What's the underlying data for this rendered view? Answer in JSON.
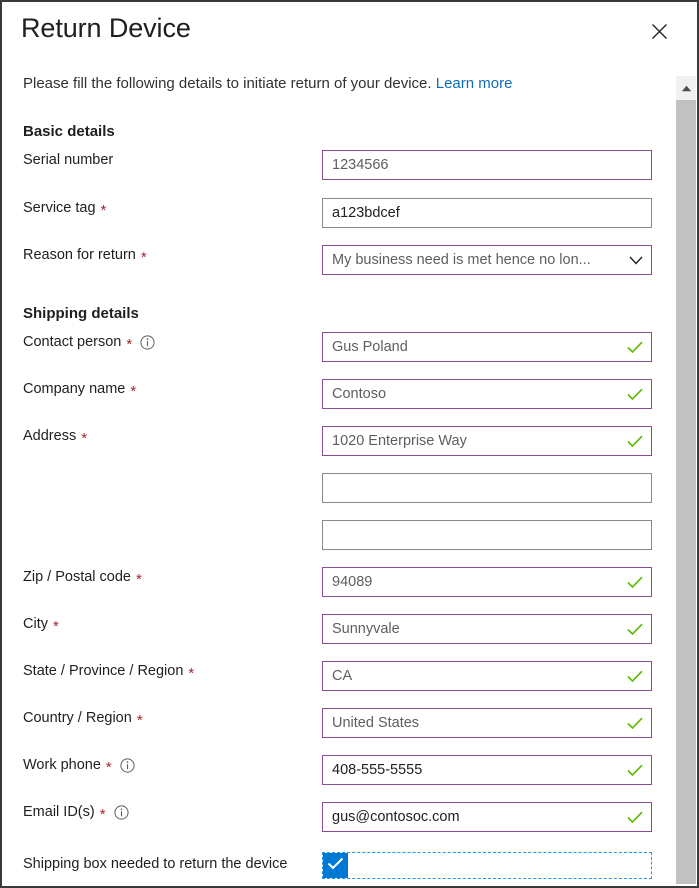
{
  "dialog": {
    "title": "Return Device",
    "close_label": "Close",
    "close_icon": "close-icon"
  },
  "intro": {
    "text": "Please fill the following details to initiate return of your device.",
    "link_label": "Learn more"
  },
  "sections": [
    {
      "id": "basic",
      "title": "Basic details"
    },
    {
      "id": "shipping",
      "title": "Shipping details"
    }
  ],
  "fields": {
    "serial_number": {
      "label": "Serial number",
      "required": false,
      "value": "1234566",
      "border": "accent",
      "validated": false
    },
    "service_tag": {
      "label": "Service tag",
      "required": true,
      "value": "a123bdcef",
      "border": "gray",
      "validated": false
    },
    "reason_for_return": {
      "label": "Reason for return",
      "required": true,
      "value": "My business need is met hence no lon...",
      "border": "accent",
      "control": "dropdown",
      "chevron_icon": "chevron-down-icon"
    },
    "contact_person": {
      "label": "Contact person",
      "required": true,
      "info": true,
      "value": "Gus Poland",
      "border": "accent",
      "validated": true
    },
    "company_name": {
      "label": "Company name",
      "required": true,
      "value": "Contoso",
      "border": "accent",
      "validated": true
    },
    "address_line1": {
      "label": "Address",
      "required": true,
      "value": "1020 Enterprise Way",
      "border": "accent",
      "validated": true
    },
    "address_line2": {
      "label": "",
      "required": false,
      "value": "",
      "border": "gray",
      "validated": false
    },
    "address_line3": {
      "label": "",
      "required": false,
      "value": "",
      "border": "gray",
      "validated": false
    },
    "zip_postal_code": {
      "label": "Zip / Postal code",
      "required": true,
      "value": "94089",
      "border": "accent",
      "validated": true
    },
    "city": {
      "label": "City",
      "required": true,
      "value": "Sunnyvale",
      "border": "accent",
      "validated": true
    },
    "state_province_region": {
      "label": "State / Province / Region",
      "required": true,
      "value": "CA",
      "border": "accent",
      "validated": true
    },
    "country_region": {
      "label": "Country / Region",
      "required": true,
      "value": "United States",
      "border": "accent",
      "validated": true
    },
    "work_phone": {
      "label": "Work phone",
      "required": true,
      "info": true,
      "value": "408-555-5555",
      "border": "accent",
      "validated": true
    },
    "email_ids": {
      "label": "Email ID(s)",
      "required": true,
      "info": true,
      "value": "gus@contosoc.com",
      "border": "accent",
      "validated": true
    }
  },
  "checkbox": {
    "label": "Shipping box needed to return the device",
    "checked": true,
    "icon": "checkmark-icon"
  },
  "icons": {
    "info": "info-icon",
    "valid": "checkmark-valid-icon",
    "scroll_up": "scroll-up-arrow-icon",
    "scroll_thumb": "scrollbar-thumb"
  },
  "colors": {
    "accent_border": "#8a4b9e",
    "gray_border": "#8a8886",
    "required_asterisk": "#a4262c",
    "link": "#0f6cbd",
    "valid_check": "#5cb800",
    "checkbox_fill": "#0078d4",
    "focus_outline": "#2196f3",
    "text": "#201f1e",
    "value_text": "#605e5c"
  },
  "required_marker": "*"
}
